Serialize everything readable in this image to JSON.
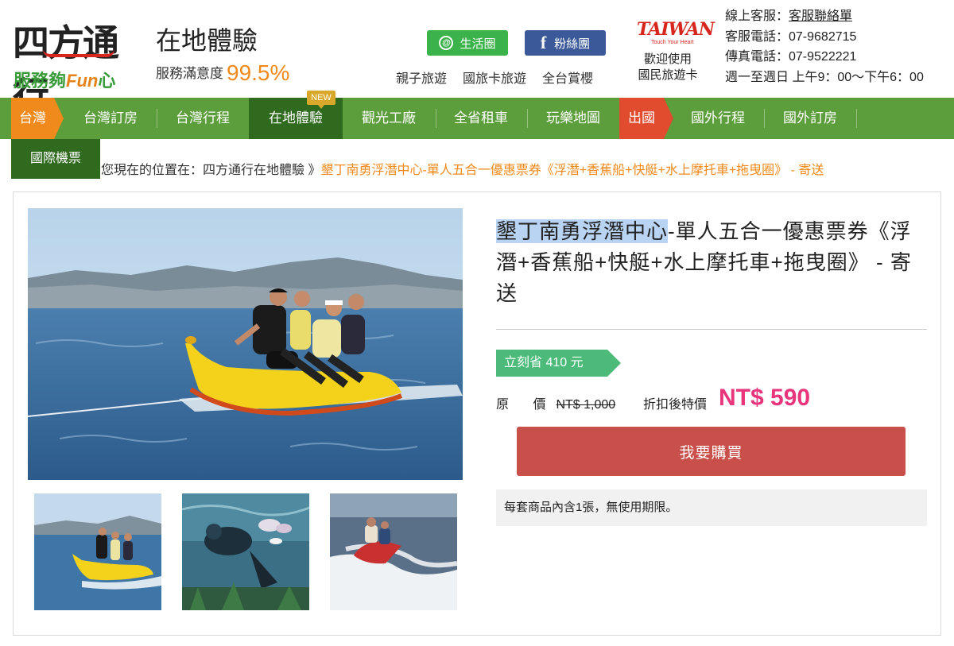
{
  "brand": {
    "name": "四方通行",
    "tagline_prefix": "服務夠",
    "tagline_fun": "Fun",
    "tagline_suffix": "心"
  },
  "header": {
    "category_title": "在地體驗",
    "satisfaction_label": "服務滿意度",
    "satisfaction_value": "99.5%",
    "life_button": "生活圈",
    "fans_button": "粉絲團",
    "top_links": [
      "親子旅遊",
      "國旅卡旅遊",
      "全台賞櫻"
    ],
    "taiwan_logo_text": "TAIWAN",
    "taiwan_logo_sub": "Touch Your Heart",
    "welcome_line1": "歡迎使用",
    "welcome_line2": "國民旅遊卡",
    "service_online_label": "線上客服：",
    "service_online_link": "客服聯絡單",
    "service_phone": "客服電話：07-9682715",
    "service_fax": "傳真電話：07-9522221",
    "service_hours": "週一至週日 上午9：00～下午6：00"
  },
  "nav": {
    "taiwan": "台灣",
    "items": [
      "台灣訂房",
      "台灣行程",
      "在地體驗",
      "觀光工廠",
      "全省租車",
      "玩樂地圖"
    ],
    "abroad": "出國",
    "abroad_items": [
      "國外行程",
      "國外訂房"
    ],
    "new_badge": "NEW",
    "sub_item": "國際機票"
  },
  "breadcrumb": {
    "prefix": "您現在的位置在：四方通行在地體驗 》",
    "current": "墾丁南勇浮潛中心-單人五合一優惠票券《浮潛+香蕉船+快艇+水上摩托車+拖曳圈》 - 寄送"
  },
  "product": {
    "title_highlight": "墾丁南勇浮潛中心",
    "title_rest": "-單人五合一優惠票券《浮潛+香蕉船+快艇+水上摩托車+拖曳圈》 - 寄送",
    "save_label": "立刻省 410 元",
    "original_label": "原 價",
    "original_price": "NT$ 1,000",
    "deal_label": "折扣後特價",
    "deal_price": "NT$ 590",
    "buy_button": "我要購買",
    "note": "每套商品內含1張，無使用期限。"
  },
  "colors": {
    "nav_green": "#5c9e3b",
    "nav_active": "#2f6a1e",
    "taiwan_orange": "#f08a1c",
    "abroad_red": "#e14b2e",
    "price_pink": "#e8357c",
    "buy_red": "#c94f4b",
    "save_green": "#4cbb7a"
  }
}
